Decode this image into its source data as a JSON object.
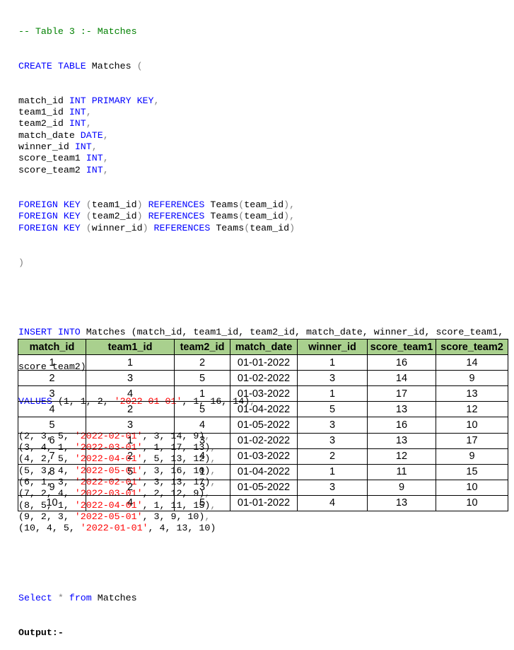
{
  "comment": "-- Table 3 :- Matches",
  "create": {
    "kw": "CREATE TABLE",
    "table": "Matches",
    "open": "(",
    "close": ")",
    "columns": [
      {
        "name": "match_id",
        "type": "INT PRIMARY KEY",
        "sep": ","
      },
      {
        "name": "team1_id",
        "type": "INT",
        "sep": ","
      },
      {
        "name": "team2_id",
        "type": "INT",
        "sep": ","
      },
      {
        "name": "match_date",
        "type": "DATE",
        "sep": ","
      },
      {
        "name": "winner_id",
        "type": "INT",
        "sep": ","
      },
      {
        "name": "score_team1",
        "type": "INT",
        "sep": ","
      },
      {
        "name": "score_team2",
        "type": "INT",
        "sep": ","
      }
    ],
    "foreign_keys": [
      {
        "fk": "FOREIGN KEY",
        "col": "team1_id",
        "ref": "REFERENCES",
        "target": "Teams",
        "target_col": "team_id",
        "sep": ","
      },
      {
        "fk": "FOREIGN KEY",
        "col": "team2_id",
        "ref": "REFERENCES",
        "target": "Teams",
        "target_col": "team_id",
        "sep": ","
      },
      {
        "fk": "FOREIGN KEY",
        "col": "winner_id",
        "ref": "REFERENCES",
        "target": "Teams",
        "target_col": "team_id",
        "sep": ""
      }
    ]
  },
  "insert": {
    "kw": "INSERT INTO",
    "rest1": " Matches (match_id, team1_id, team2_id, match_date, winner_id, score_team1,",
    "rest2": "score_team2)",
    "values_kw": "VALUES",
    "rows": [
      {
        "pre": "(1, 1, 2, ",
        "date": "'2022-01-01'",
        "post": ", 1, 16, 14)",
        "sep": ","
      },
      {
        "pre": "(2, 3, 5, ",
        "date": "'2022-02-01'",
        "post": ", 3, 14, 9)",
        "sep": ","
      },
      {
        "pre": "(3, 4, 1, ",
        "date": "'2022-03-01'",
        "post": ", 1, 17, 13)",
        "sep": ","
      },
      {
        "pre": "(4, 2, 5, ",
        "date": "'2022-04-01'",
        "post": ", 5, 13, 12)",
        "sep": ","
      },
      {
        "pre": "(5, 3, 4, ",
        "date": "'2022-05-01'",
        "post": ", 3, 16, 10)",
        "sep": ","
      },
      {
        "pre": "(6, 1, 3, ",
        "date": "'2022-02-01'",
        "post": ", 3, 13, 17)",
        "sep": ","
      },
      {
        "pre": "(7, 2, 4, ",
        "date": "'2022-03-01'",
        "post": ", 2, 12, 9)",
        "sep": ","
      },
      {
        "pre": "(8, 5, 1, ",
        "date": "'2022-04-01'",
        "post": ", 1, 11, 15)",
        "sep": ","
      },
      {
        "pre": "(9, 2, 3, ",
        "date": "'2022-05-01'",
        "post": ", 3, 9, 10)",
        "sep": ","
      },
      {
        "pre": "(10, 4, 5, ",
        "date": "'2022-01-01'",
        "post": ", 4, 13, 10)",
        "sep": ""
      }
    ]
  },
  "select": {
    "kw1": "Select",
    "star": "*",
    "kw2": "from",
    "table": "Matches"
  },
  "output_label": "Output:-",
  "result": {
    "headers": [
      "match_id",
      "team1_id",
      "team2_id",
      "match_date",
      "winner_id",
      "score_team1",
      "score_team2"
    ],
    "rows": [
      [
        "1",
        "1",
        "2",
        "01-01-2022",
        "1",
        "16",
        "14"
      ],
      [
        "2",
        "3",
        "5",
        "01-02-2022",
        "3",
        "14",
        "9"
      ],
      [
        "3",
        "4",
        "1",
        "01-03-2022",
        "1",
        "17",
        "13"
      ],
      [
        "4",
        "2",
        "5",
        "01-04-2022",
        "5",
        "13",
        "12"
      ],
      [
        "5",
        "3",
        "4",
        "01-05-2022",
        "3",
        "16",
        "10"
      ],
      [
        "6",
        "1",
        "3",
        "01-02-2022",
        "3",
        "13",
        "17"
      ],
      [
        "7",
        "2",
        "4",
        "01-03-2022",
        "2",
        "12",
        "9"
      ],
      [
        "8",
        "5",
        "1",
        "01-04-2022",
        "1",
        "11",
        "15"
      ],
      [
        "9",
        "2",
        "3",
        "01-05-2022",
        "3",
        "9",
        "10"
      ],
      [
        "10",
        "4",
        "5",
        "01-01-2022",
        "4",
        "13",
        "10"
      ]
    ]
  }
}
